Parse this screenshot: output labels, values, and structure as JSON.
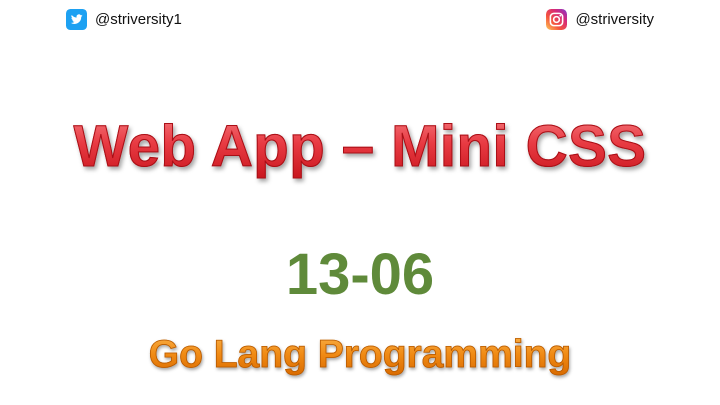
{
  "header": {
    "twitter": {
      "icon": "twitter-icon",
      "handle": "@striversity1",
      "color": "#1da1f2"
    },
    "instagram": {
      "icon": "instagram-icon",
      "handle": "@striversity"
    }
  },
  "slide": {
    "title": "Web App – Mini CSS",
    "number": "13-06",
    "subtitle": "Go Lang Programming",
    "colors": {
      "title": "#e02a32",
      "number": "#5f8a3a",
      "subtitle": "#f08a14"
    }
  }
}
